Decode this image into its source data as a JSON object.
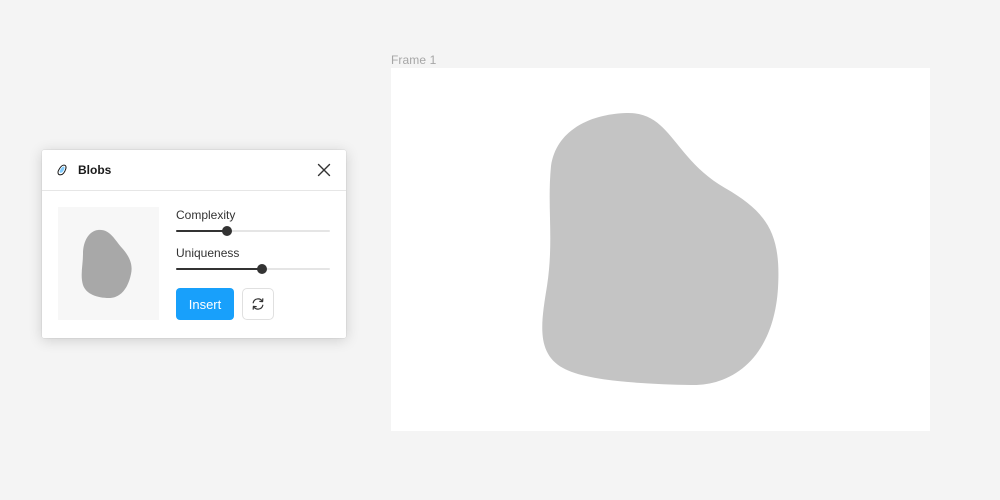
{
  "canvas": {
    "frame_label": "Frame 1",
    "blob_color": "#c4c4c4"
  },
  "plugin": {
    "title": "Blobs",
    "icon": "blob-icon",
    "close_icon": "close-icon",
    "preview_blob_color": "#a8a8a8",
    "complexity": {
      "label": "Complexity",
      "value": 0.33
    },
    "uniqueness": {
      "label": "Uniqueness",
      "value": 0.56
    },
    "insert_label": "Insert",
    "insert_color": "#18a0fb",
    "refresh_icon": "refresh-icon"
  }
}
